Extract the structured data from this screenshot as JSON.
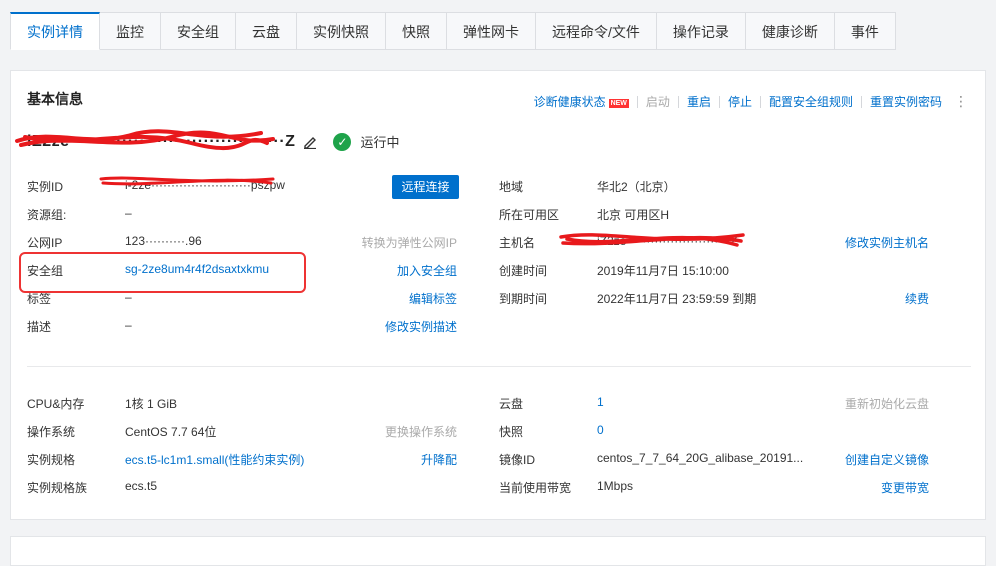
{
  "tabs": [
    {
      "label": "实例详情",
      "active": true
    },
    {
      "label": "监控"
    },
    {
      "label": "安全组"
    },
    {
      "label": "云盘"
    },
    {
      "label": "实例快照"
    },
    {
      "label": "快照"
    },
    {
      "label": "弹性网卡"
    },
    {
      "label": "远程命令/文件"
    },
    {
      "label": "操作记录"
    },
    {
      "label": "健康诊断"
    },
    {
      "label": "事件"
    }
  ],
  "basic": {
    "title": "基本信息",
    "actions": {
      "diagnose": "诊断健康状态",
      "new_badge": "NEW",
      "start": "启动",
      "restart": "重启",
      "stop": "停止",
      "config_sg_rules": "配置安全组规则",
      "reset_password": "重置实例密码",
      "more": "⋮"
    },
    "instance_name": "iZ2ze·····································Z",
    "status": "运行中",
    "status_color": "#1ea34a",
    "left_fields": {
      "instance_id": {
        "label": "实例ID",
        "value": "i-2ze·························pszpw"
      },
      "resource_group": {
        "label": "资源组:",
        "value": "–"
      },
      "public_ip": {
        "label": "公网IP",
        "value": "123··········.96"
      },
      "security_group": {
        "label": "安全组",
        "value": "sg-2ze8um4r4f2dsaxtxkmu"
      },
      "tags": {
        "label": "标签",
        "value": "–"
      },
      "description": {
        "label": "描述",
        "value": "–"
      }
    },
    "left_actions": {
      "remote_connect": "远程连接",
      "convert_eip": "转换为弹性公网IP",
      "join_sg": "加入安全组",
      "edit_tags": "编辑标签",
      "edit_desc": "修改实例描述"
    },
    "right_fields": {
      "region": {
        "label": "地域",
        "value": "华北2（北京）"
      },
      "zone": {
        "label": "所在可用区",
        "value": "北京 可用区H"
      },
      "hostname": {
        "label": "主机名",
        "value": "iZ2ze··························Z"
      },
      "created": {
        "label": "创建时间",
        "value": "2019年11月7日 15:10:00"
      },
      "expires": {
        "label": "到期时间",
        "value": "2022年11月7日 23:59:59 到期"
      }
    },
    "right_actions": {
      "edit_hostname": "修改实例主机名",
      "renew": "续费"
    }
  },
  "config": {
    "left_fields": {
      "cpu_mem": {
        "label": "CPU&内存",
        "value": "1核 1 GiB"
      },
      "os": {
        "label": "操作系统",
        "value": "CentOS 7.7 64位"
      },
      "spec": {
        "label": "实例规格",
        "value": "ecs.t5-lc1m1.small(性能约束实例)"
      },
      "family": {
        "label": "实例规格族",
        "value": "ecs.t5"
      }
    },
    "left_actions": {
      "change_os": "更换操作系统",
      "upgrade": "升降配"
    },
    "right_fields": {
      "disk": {
        "label": "云盘",
        "value": "1"
      },
      "snapshot": {
        "label": "快照",
        "value": "0"
      },
      "image_id": {
        "label": "镜像ID",
        "value": "centos_7_7_64_20G_alibase_20191..."
      },
      "bandwidth": {
        "label": "当前使用带宽",
        "value": "1Mbps"
      }
    },
    "right_actions": {
      "reinit_disk": "重新初始化云盘",
      "create_image": "创建自定义镜像",
      "change_bw": "变更带宽"
    }
  }
}
